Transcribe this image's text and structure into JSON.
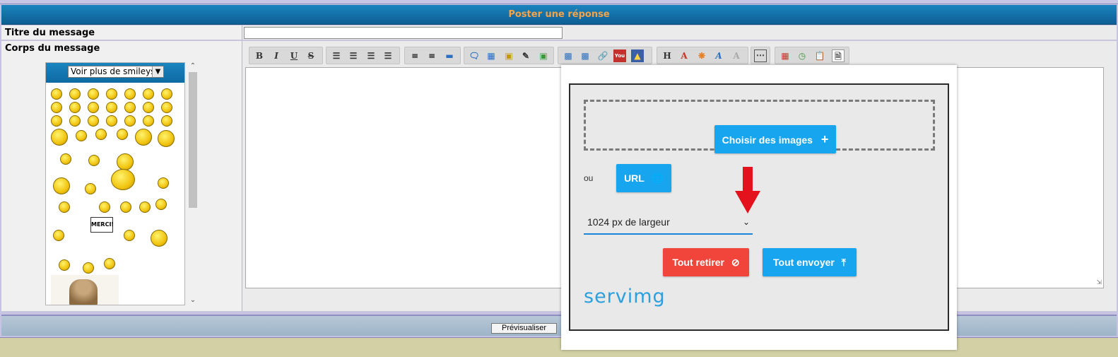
{
  "header": {
    "title": "Poster une réponse"
  },
  "form": {
    "title_label": "Titre du message",
    "title_value": "",
    "body_label": "Corps du message"
  },
  "smileys": {
    "select_label": "Voir plus de smileys",
    "sign_text": "MERCI!"
  },
  "toolbar": {
    "bold": "B",
    "italic": "I",
    "underline": "U",
    "strike": "S",
    "heading": "H"
  },
  "upload": {
    "choose_label": "Choisir des images",
    "or_label": "ou",
    "url_label": "URL",
    "size_value": "1024 px de largeur",
    "remove_label": "Tout retirer",
    "send_label": "Tout envoyer",
    "brand": "servimg",
    "accent_color": "#17a5f0",
    "danger_color": "#f1453b"
  },
  "bottom": {
    "preview_label": "Prévisualiser"
  }
}
